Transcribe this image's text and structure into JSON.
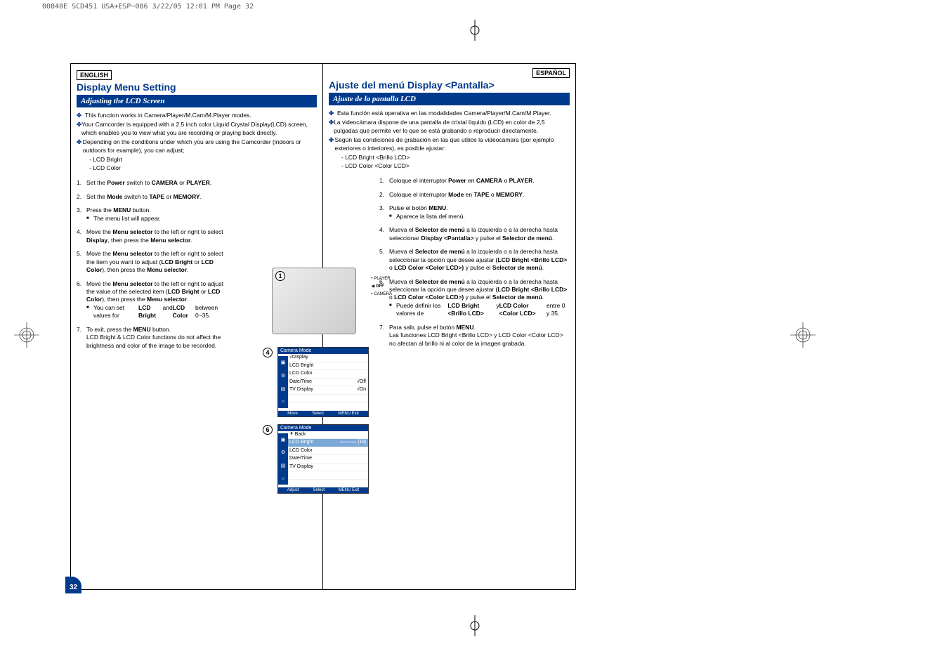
{
  "header": "00840E SCD451 USA+ESP~086  3/22/05 12:01 PM  Page 32",
  "page_number": "32",
  "en": {
    "lang": "ENGLISH",
    "title": "Display Menu Setting",
    "subtitle": "Adjusting the LCD Screen",
    "intro": [
      "This function works in Camera/Player/M.Cam/M.Player modes.",
      "Your Camcorder is equipped with a 2.5 inch color Liquid Crystal Display(LCD) screen, which enables you to view what you are recording or playing back directly.",
      "Depending on the conditions under which you are using the Camcorder (indoors or outdoors for example), you can adjust;"
    ],
    "intro_sub": [
      "- LCD Bright",
      "- LCD Color"
    ],
    "steps": [
      {
        "n": "1.",
        "t": "Set the <b>Power</b> switch to <b>CAMERA</b> or <b>PLAYER</b>."
      },
      {
        "n": "2.",
        "t": "Set the <b>Mode</b> switch to <b>TAPE</b> or <b>MEMORY</b>."
      },
      {
        "n": "3.",
        "t": "Press the <b>MENU</b> button.",
        "sq": [
          "The menu list will appear."
        ]
      },
      {
        "n": "4.",
        "t": "Move the <b>Menu selector</b> to the left or right to select <b>Display</b>, then press the <b>Menu selector</b>."
      },
      {
        "n": "5.",
        "t": "Move the <b>Menu selector</b> to the left or right to select the item you want to adjust (<b>LCD Bright</b> or <b>LCD Color</b>), then press the <b>Menu selector</b>."
      },
      {
        "n": "6.",
        "t": "Move the <b>Menu selector</b> to the left or right to adjust the value of the selected item (<b>LCD Bright</b> or <b>LCD Color</b>), then press the <b>Menu selector</b>.",
        "sq": [
          "You can set values for <b>LCD Bright</b> and <b>LCD Color</b> between 0~35."
        ]
      },
      {
        "n": "7.",
        "t": "To exit, press the <b>MENU</b> button.<br>LCD Bright & LCD Color functions do not affect the brightness and color of the image to be recorded."
      }
    ]
  },
  "es": {
    "lang": "ESPAÑOL",
    "title": "Ajuste del menú Display <Pantalla>",
    "subtitle": "Ajuste de la pantalla LCD",
    "intro": [
      "Esta función está operativa en las modalidades Camera/Player/M.Cam/M.Player.",
      "La videocámara dispone de una pantalla de cristal líquido (LCD) en color de 2,5 pulgadas que permite ver lo que se está grabando o reproducir directamente.",
      "Según las condiciones de grabación en las que utilice la videocámara (por ejemplo exteriores o interiores), es posible ajustar:"
    ],
    "intro_sub": [
      "- LCD Bright <Brillo LCD>",
      "- LCD Color <Color LCD>"
    ],
    "steps": [
      {
        "n": "1.",
        "t": "Coloque el interruptor <b>Power</b> en <b>CAMERA</b> o <b>PLAYER</b>."
      },
      {
        "n": "2.",
        "t": "Coloque el interruptor <b>Mode</b> en <b>TAPE</b> o <b>MEMORY</b>."
      },
      {
        "n": "3.",
        "t": "Pulse el botón <b>MENU</b>.",
        "sq": [
          "Aparece la lista del menú."
        ]
      },
      {
        "n": "4.",
        "t": "Mueva el <b>Selector de menú</b> a la izquierda o a la derecha hasta seleccionar <b>Display &lt;Pantalla&gt;</b> y pulse el <b>Selector de menú</b>."
      },
      {
        "n": "5.",
        "t": "Mueva el <b>Selector de menú</b> a la izquierda o a la derecha hasta seleccionar la opción que desee ajustar <b>(LCD Bright &lt;Brillo LCD&gt;</b> o <b>LCD Color &lt;Color LCD&gt;)</b> y pulse el <b>Selector de menú</b>."
      },
      {
        "n": "6.",
        "t": "Mueva el <b>Selector de menú</b> a la izquierda o a la derecha hasta seleccionar la opción que desee ajustar <b>(LCD Bright &lt;Brillo LCD&gt;</b> o <b>LCD Color &lt;Color LCD&gt;)</b> y pulse el <b>Selector de menú</b>.",
        "sq": [
          "Puede definir los valores de <b>LCD Bright &lt;Brillo LCD&gt;</b> y <b>LCD Color &lt;Color LCD&gt;</b> entre 0 y 35."
        ]
      },
      {
        "n": "7.",
        "t": "Para salir, pulse el botón <b>MENU</b>.<br>Las funciones LCD Bright &lt;Brillo LCD&gt; y LCD Color &lt;Color LCD&gt; no afectan al brillo ni al color de la imagen grabada."
      }
    ]
  },
  "fig": {
    "c1": "1",
    "c4": "4",
    "c6": "6",
    "dial": {
      "player": "PLAYER",
      "off": "OFF",
      "camera": "CAMERA"
    },
    "menu4": {
      "title": "Camera Mode",
      "rows": [
        {
          "l": "√Display",
          "r": ""
        },
        {
          "l": "LCD Bright",
          "r": ""
        },
        {
          "l": "LCD Color",
          "r": ""
        },
        {
          "l": "Date/Time",
          "r": "√Off"
        },
        {
          "l": "TV Display",
          "r": "√On"
        }
      ],
      "foot": {
        "a": "Move",
        "b": "Select",
        "c": "Exit"
      }
    },
    "menu6": {
      "title": "Camera Mode",
      "rows": [
        {
          "l": "↟ Back",
          "r": ""
        },
        {
          "l": "LCD Bright",
          "r": "",
          "hl": true,
          "slider": "[18]"
        },
        {
          "l": "LCD Color",
          "r": ""
        },
        {
          "l": "Date/Time",
          "r": ""
        },
        {
          "l": "TV Display",
          "r": ""
        }
      ],
      "foot": {
        "a": "Adjust",
        "b": "Select",
        "c": "Exit"
      }
    }
  }
}
